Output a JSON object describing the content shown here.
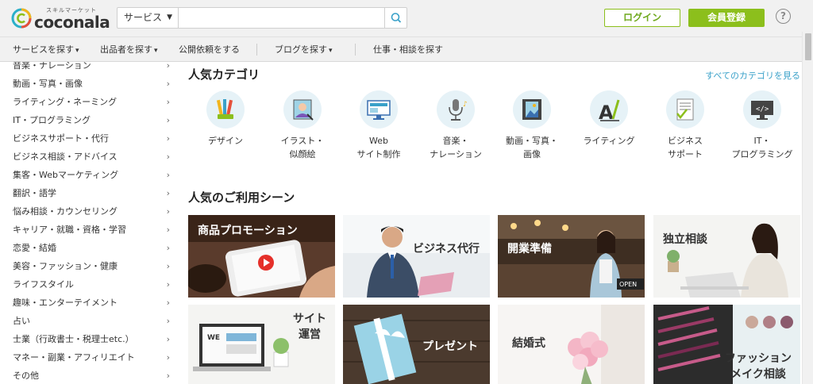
{
  "header": {
    "logo_small": "スキルマーケット",
    "logo_main": "coconala",
    "search_category": "サービス",
    "search_placeholder": "",
    "login_label": "ログイン",
    "register_label": "会員登録",
    "help_label": "?"
  },
  "nav": {
    "items": [
      {
        "label": "サービスを探す",
        "has_chevron": true
      },
      {
        "label": "出品者を探す",
        "has_chevron": true
      },
      {
        "label": "公開依頼をする",
        "has_chevron": false
      },
      {
        "label": "ブログを探す",
        "has_chevron": true
      },
      {
        "label": "仕事・相談を探す",
        "has_chevron": false
      }
    ]
  },
  "sidebar": {
    "items": [
      {
        "label": "音楽・ナレーション"
      },
      {
        "label": "動画・写真・画像"
      },
      {
        "label": "ライティング・ネーミング"
      },
      {
        "label": "IT・プログラミング"
      },
      {
        "label": "ビジネスサポート・代行"
      },
      {
        "label": "ビジネス相談・アドバイス"
      },
      {
        "label": "集客・Webマーケティング"
      },
      {
        "label": "翻訳・語学"
      },
      {
        "label": "悩み相談・カウンセリング"
      },
      {
        "label": "キャリア・就職・資格・学習"
      },
      {
        "label": "恋愛・結婚"
      },
      {
        "label": "美容・ファッション・健康"
      },
      {
        "label": "ライフスタイル"
      },
      {
        "label": "趣味・エンターテイメント"
      },
      {
        "label": "占い"
      },
      {
        "label": "士業（行政書士・税理士etc.）"
      },
      {
        "label": "マネー・副業・アフィリエイト"
      },
      {
        "label": "その他"
      }
    ]
  },
  "popular_categories": {
    "title": "人気カテゴリ",
    "see_all": "すべてのカテゴリを見る",
    "items": [
      {
        "icon": "design-pencils-icon",
        "line1": "デザイン",
        "line2": ""
      },
      {
        "icon": "illustration-portrait-icon",
        "line1": "イラスト・",
        "line2": "似顔絵"
      },
      {
        "icon": "web-monitor-icon",
        "line1": "Web",
        "line2": "サイト制作"
      },
      {
        "icon": "microphone-icon",
        "line1": "音楽・",
        "line2": "ナレーション"
      },
      {
        "icon": "film-photo-icon",
        "line1": "動画・写真・",
        "line2": "画像"
      },
      {
        "icon": "writing-pen-icon",
        "line1": "ライティング",
        "line2": ""
      },
      {
        "icon": "business-document-icon",
        "line1": "ビジネス",
        "line2": "サポート"
      },
      {
        "icon": "code-monitor-icon",
        "line1": "IT・",
        "line2": "プログラミング"
      }
    ]
  },
  "usage_scenes": {
    "title": "人気のご利用シーン",
    "tiles": [
      {
        "label": "商品プロモーション"
      },
      {
        "label": "ビジネス代行"
      },
      {
        "label": "開業準備"
      },
      {
        "label": "独立相談"
      },
      {
        "label_line1": "サイト",
        "label_line2": "運営",
        "screen_text": "WE"
      },
      {
        "label": "プレゼント"
      },
      {
        "label": "結婚式"
      },
      {
        "label_line1": "ファッション",
        "label_line2": "メイク相談"
      }
    ],
    "sign_text": "OPEN"
  },
  "colors": {
    "brand_green": "#8cbf1c",
    "link_blue": "#3aa1c9",
    "icon_bg": "#e6f2f7",
    "header_bg": "#f1f1f1"
  }
}
